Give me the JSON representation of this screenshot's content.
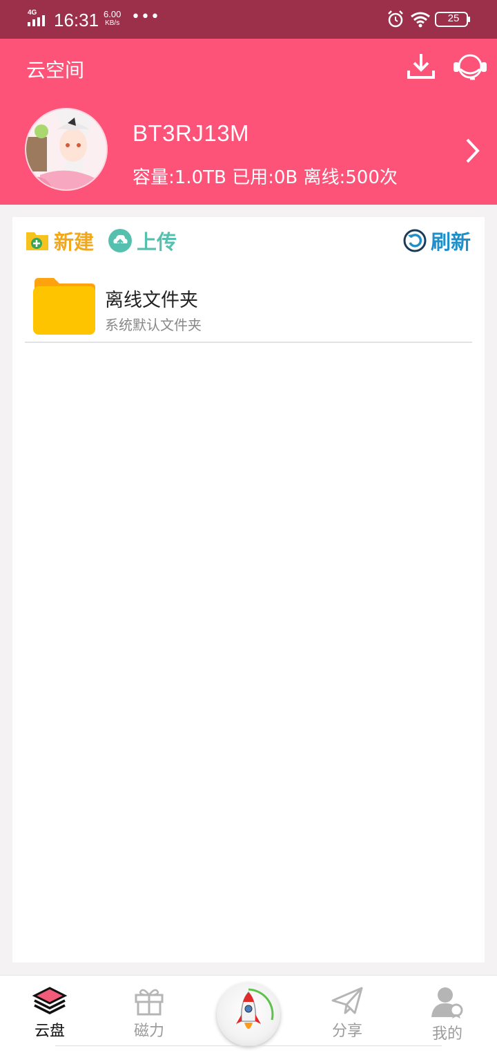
{
  "status_bar": {
    "network": "4G",
    "time": "16:31",
    "speed_value": "6.00",
    "speed_unit": "KB/s",
    "more": "•••",
    "battery": "25"
  },
  "header": {
    "title": "云空间",
    "username": "BT3RJ13M",
    "quota_text": "容量:1.0TB 已用:0B 离线:500次",
    "download_icon": "download-icon",
    "support_icon": "customer-service-icon"
  },
  "toolbar": {
    "new_label": "新建",
    "upload_label": "上传",
    "refresh_label": "刷新"
  },
  "files": [
    {
      "name": "离线文件夹",
      "description": "系统默认文件夹",
      "icon": "folder-icon"
    }
  ],
  "nav": {
    "cloud_label": "云盘",
    "magnet_label": "磁力",
    "share_label": "分享",
    "mine_label": "我的",
    "active": "云盘"
  },
  "colors": {
    "status_bar": "#9c304b",
    "header": "#fd5378",
    "new": "#f2a81b",
    "upload": "#55c0ae",
    "refresh": "#1e8fc9",
    "folder": "#ffc300"
  }
}
